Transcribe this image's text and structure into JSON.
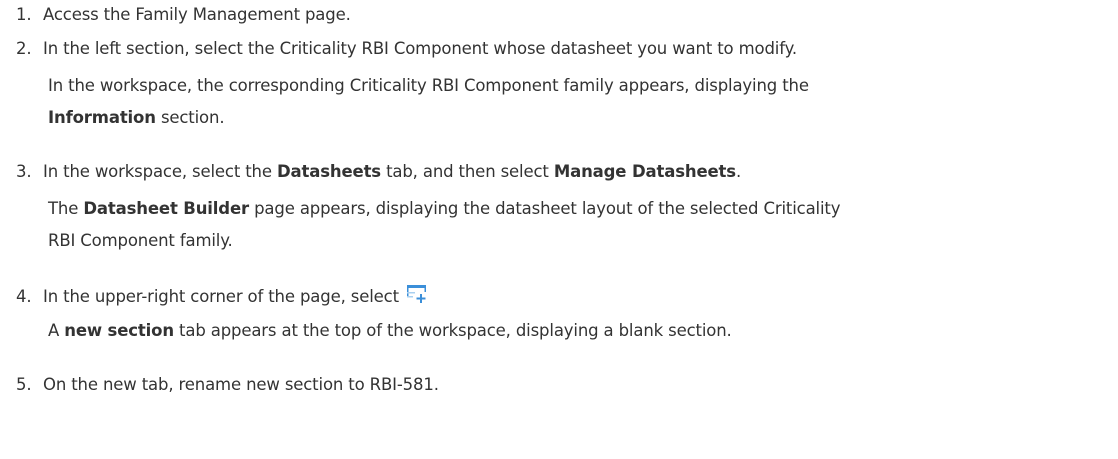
{
  "steps": [
    {
      "number": "1.",
      "text": "Access the Family Management page."
    },
    {
      "number": "2.",
      "text": "In the left section, select the Criticality RBI Component whose datasheet you want to modify.",
      "result": {
        "part1": "In the workspace, the corresponding Criticality RBI Component family appears, displaying the",
        "bold1": "Information",
        "part2": " section."
      }
    },
    {
      "number": "3.",
      "part1": "In the workspace, select the ",
      "bold1": "Datasheets",
      "part2": " tab, and then select ",
      "bold2": "Manage Datasheets",
      "part3": ".",
      "result": {
        "part1": "The ",
        "bold1": "Datasheet Builder",
        "part2": " page appears, displaying the datasheet layout of the selected Criticality",
        "part3": "RBI Component family."
      }
    },
    {
      "number": "4.",
      "text": "In the upper-right corner of the page, select ",
      "icon": "add-section-icon",
      "result": {
        "part1": "A ",
        "bold1": "new section",
        "part2": " tab appears at the top of the workspace, displaying a blank section."
      }
    },
    {
      "number": "5.",
      "text": "On the new tab, rename new section to RBI-581."
    }
  ],
  "colors": {
    "text": "#333333",
    "icon_blue": "#3b8fd9",
    "icon_light": "#a9d0f0"
  }
}
